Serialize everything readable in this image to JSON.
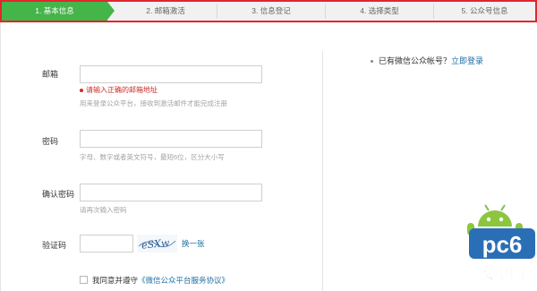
{
  "steps": [
    {
      "label": "1. 基本信息",
      "active": true
    },
    {
      "label": "2. 邮箱激活",
      "active": false
    },
    {
      "label": "3. 信息登记",
      "active": false
    },
    {
      "label": "4. 选择类型",
      "active": false
    },
    {
      "label": "5. 公众号信息",
      "active": false
    }
  ],
  "form": {
    "email": {
      "label": "邮箱",
      "value": "",
      "error": "请输入正确的邮箱地址",
      "hint": "用来登录公众平台，接收到激活邮件才能完成注册"
    },
    "password": {
      "label": "密码",
      "value": "",
      "hint": "字母、数字或者英文符号，最短6位，区分大小写"
    },
    "confirm": {
      "label": "确认密码",
      "value": "",
      "hint": "请再次输入密码"
    },
    "captcha": {
      "label": "验证码",
      "value": "",
      "image_text": "eSXw",
      "refresh": "换一张"
    },
    "agree": {
      "prefix": "我同意并遵守",
      "link": "《微信公众平台服务协议》"
    }
  },
  "aside": {
    "question": "已有微信公众帐号？",
    "login_link": "立即登录"
  },
  "watermark": {
    "text_top": "pc6",
    "text_bottom": "安卓网",
    "color": "#2a6fb5"
  },
  "colors": {
    "accent": "#44b549",
    "error": "#c9302c",
    "link": "#1c6ea4",
    "highlight_border": "#e0262f"
  }
}
